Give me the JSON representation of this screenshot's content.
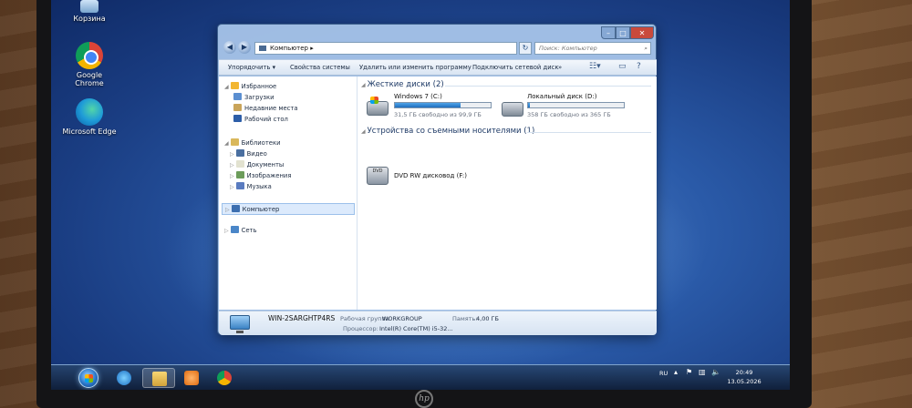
{
  "desktop": {
    "icons": [
      {
        "label": "Корзина"
      },
      {
        "label": "Google Chrome"
      },
      {
        "label": "Microsoft Edge"
      }
    ]
  },
  "window": {
    "address": "Компьютер",
    "search_placeholder": "Поиск: Компьютер",
    "toolbar": {
      "organize": "Упорядочить",
      "system_properties": "Свойства системы",
      "uninstall": "Удалить или изменить программу",
      "map_drive": "Подключить сетевой диск",
      "more": "»"
    },
    "sidebar": {
      "favorites": "Избранное",
      "downloads": "Загрузки",
      "recent": "Недавние места",
      "desktop": "Рабочий стол",
      "libraries": "Библиотеки",
      "video": "Видео",
      "documents": "Документы",
      "pictures": "Изображения",
      "music": "Музыка",
      "computer": "Компьютер",
      "network": "Сеть"
    },
    "hard_drives": {
      "header": "Жесткие диски (2)",
      "drives": [
        {
          "name": "Windows 7 (C:)",
          "free": "31,5 ГБ свободно из 99,9 ГБ",
          "used_fraction": 0.685
        },
        {
          "name": "Локальный диск (D:)",
          "free": "358 ГБ свободно из 365 ГБ",
          "used_fraction": 0.02
        }
      ]
    },
    "removable": {
      "header": "Устройства со съемными носителями (1)",
      "dvd_name": "DVD RW дисковод (F:)",
      "dvd_badge": "DVD"
    },
    "details": {
      "computer_name": "WIN-2SARGHTP4RS",
      "workgroup_label": "Рабочая группа:",
      "workgroup": "WORKGROUP",
      "memory_label": "Память:",
      "memory": "4,00 ГБ",
      "cpu_label": "Процессор:",
      "cpu": "Intel(R) Core(TM) i5-32..."
    }
  },
  "taskbar": {
    "language": "RU",
    "time": "20:49",
    "date": "13.05.2026"
  },
  "laptop_logo": "hp"
}
